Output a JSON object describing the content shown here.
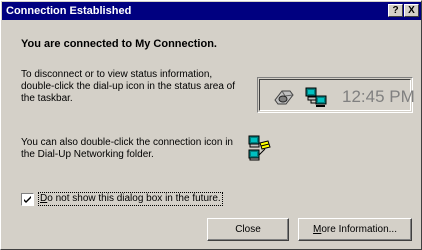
{
  "window": {
    "title": "Connection Established",
    "help_glyph": "?",
    "close_glyph": "X"
  },
  "heading": "You are connected to My Connection.",
  "disconnect_text": "To disconnect or to view status information, double-click the dial-up icon in the status area of the taskbar.",
  "tray": {
    "clock": "12:45 PM",
    "icons": [
      "speaker-icon",
      "network-connection-icon"
    ]
  },
  "folder_text": "You can also double-click the connection icon in the Dial-Up Networking folder.",
  "checkbox": {
    "checked": true,
    "label_access_key": "D",
    "label_rest": "o not show this dialog box in the future."
  },
  "buttons": {
    "close_label": "Close",
    "more_access_key": "M",
    "more_rest": "ore Information..."
  },
  "colors": {
    "titlebar": "#000080",
    "face": "#d4d0c8"
  }
}
